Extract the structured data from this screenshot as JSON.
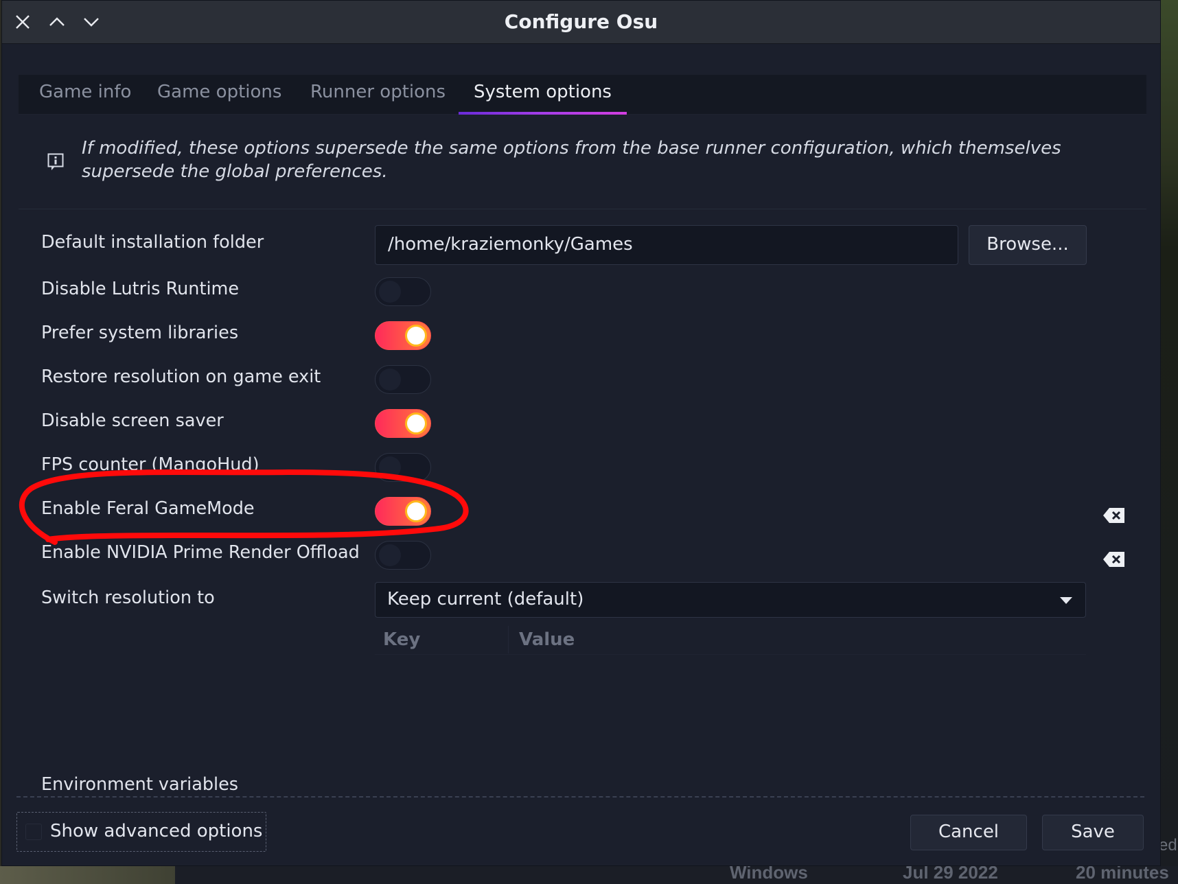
{
  "window": {
    "title": "Configure Osu"
  },
  "tabs": [
    {
      "label": "Game info",
      "active": false
    },
    {
      "label": "Game options",
      "active": false
    },
    {
      "label": "Runner options",
      "active": false
    },
    {
      "label": "System options",
      "active": true
    }
  ],
  "notice": {
    "text": "If modified, these options supersede the same options from the base runner configuration, which themselves supersede the global preferences.",
    "icon": "info-icon"
  },
  "options": {
    "install_folder": {
      "label": "Default installation folder",
      "value": "/home/kraziemonky/Games",
      "browse_label": "Browse..."
    },
    "toggles": [
      {
        "label": "Disable Lutris Runtime",
        "on": false,
        "has_reset": false
      },
      {
        "label": "Prefer system libraries",
        "on": true,
        "has_reset": false
      },
      {
        "label": "Restore resolution on game exit",
        "on": false,
        "has_reset": false
      },
      {
        "label": "Disable screen saver",
        "on": true,
        "has_reset": false
      },
      {
        "label": "FPS counter (MangoHud)",
        "on": false,
        "has_reset": false
      },
      {
        "label": "Enable Feral GameMode",
        "on": true,
        "has_reset": true
      },
      {
        "label": "Enable NVIDIA Prime Render Offload",
        "on": false,
        "has_reset": true
      }
    ],
    "switch_resolution": {
      "label": "Switch resolution to",
      "selected": "Keep current (default)"
    },
    "env_vars": {
      "label": "Environment variables",
      "columns": [
        "Key",
        "Value"
      ]
    }
  },
  "footer": {
    "show_advanced_label": "Show advanced options",
    "show_advanced_checked": false,
    "cancel_label": "Cancel",
    "save_label": "Save"
  },
  "background": {
    "taskbar_texts": [
      "Windows",
      "Jul 29 2022",
      "20 minutes"
    ],
    "right_edge_text": "ed"
  },
  "colors": {
    "toggle_on_start": "#ff2a5a",
    "toggle_on_end": "#ff7a3a",
    "knob_ring": "#ffb81c",
    "tab_accent": "#a53ee8",
    "annotation": "#ff0a0a",
    "window_bg": "#1b1f2c"
  }
}
